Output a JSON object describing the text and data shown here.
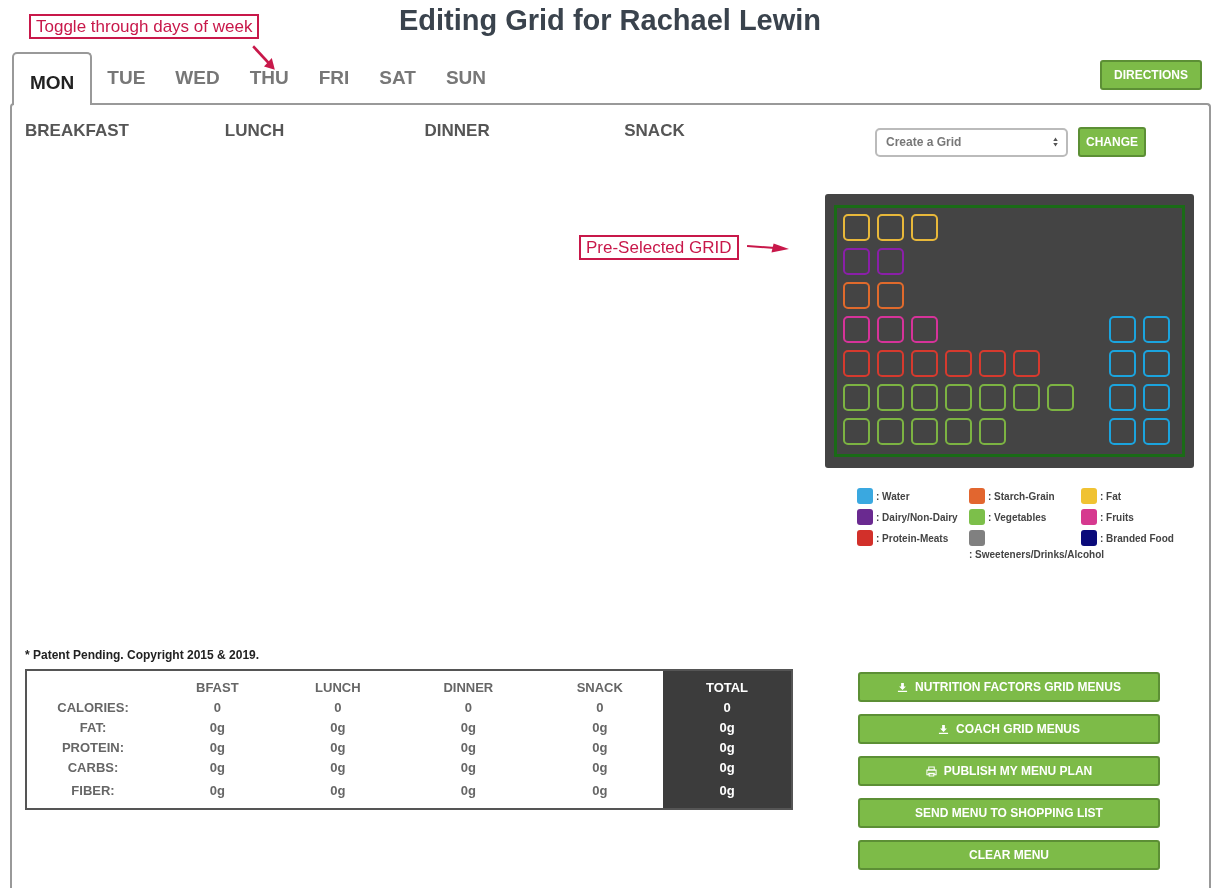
{
  "title": "Editing Grid for Rachael Lewin",
  "tabs": [
    {
      "label": "MON",
      "selected": true
    },
    {
      "label": "TUE",
      "selected": false
    },
    {
      "label": "WED",
      "selected": false
    },
    {
      "label": "THU",
      "selected": false
    },
    {
      "label": "FRI",
      "selected": false
    },
    {
      "label": "SAT",
      "selected": false
    },
    {
      "label": "SUN",
      "selected": false
    }
  ],
  "directions_button": "DIRECTIONS",
  "meals": [
    "BREAKFAST",
    "LUNCH",
    "DINNER",
    "SNACK"
  ],
  "grid_select": {
    "value": "Create a Grid"
  },
  "change_button": "CHANGE",
  "grid": {
    "rows": [
      {
        "cells": [
          {
            "color": "#e8b83a"
          },
          {
            "color": "#e8b83a"
          },
          {
            "color": "#e8b83a"
          }
        ],
        "side": []
      },
      {
        "cells": [
          {
            "color": "#8a1fa8"
          },
          {
            "color": "#8a1fa8"
          }
        ],
        "side": []
      },
      {
        "cells": [
          {
            "color": "#e06a2c"
          },
          {
            "color": "#e06a2c"
          }
        ],
        "side": []
      },
      {
        "cells": [
          {
            "color": "#d6339a"
          },
          {
            "color": "#d6339a"
          },
          {
            "color": "#d6339a"
          }
        ],
        "side": [
          {
            "color": "#1ba4de"
          },
          {
            "color": "#1ba4de"
          }
        ]
      },
      {
        "cells": [
          {
            "color": "#d63a2e"
          },
          {
            "color": "#d63a2e"
          },
          {
            "color": "#d63a2e"
          },
          {
            "color": "#d63a2e"
          },
          {
            "color": "#d63a2e"
          },
          {
            "color": "#d63a2e"
          }
        ],
        "side": [
          {
            "color": "#1ba4de"
          },
          {
            "color": "#1ba4de"
          }
        ]
      },
      {
        "cells": [
          {
            "color": "#7cb342"
          },
          {
            "color": "#7cb342"
          },
          {
            "color": "#7cb342"
          },
          {
            "color": "#7cb342"
          },
          {
            "color": "#7cb342"
          },
          {
            "color": "#7cb342"
          },
          {
            "color": "#7cb342"
          }
        ],
        "side": [
          {
            "color": "#1ba4de"
          },
          {
            "color": "#1ba4de"
          }
        ]
      },
      {
        "cells": [
          {
            "color": "#7cb342"
          },
          {
            "color": "#7cb342"
          },
          {
            "color": "#7cb342"
          },
          {
            "color": "#7cb342"
          },
          {
            "color": "#7cb342"
          }
        ],
        "side": [
          {
            "color": "#1ba4de"
          },
          {
            "color": "#1ba4de"
          }
        ]
      }
    ]
  },
  "legend": [
    {
      "label": ": Water",
      "color": "#3aa8e0"
    },
    {
      "label": ": Starch-Grain",
      "color": "#e2662f"
    },
    {
      "label": ": Fat",
      "color": "#f0c232"
    },
    {
      "label": ": Dairy/Non-Dairy",
      "color": "#6a2a90"
    },
    {
      "label": ": Vegetables",
      "color": "#7cbf4a"
    },
    {
      "label": ": Fruits",
      "color": "#d6398f"
    },
    {
      "label": ": Protein-Meats",
      "color": "#d2302a"
    },
    {
      "label": ": Sweeteners/Drinks/Alcohol",
      "color": "#808080"
    },
    {
      "label": ": Branded Food",
      "color": "#0a0a7a"
    }
  ],
  "copyright": "* Patent Pending. Copyright 2015 & 2019.",
  "nutrition_table": {
    "columns": [
      "BFAST",
      "LUNCH",
      "DINNER",
      "SNACK",
      "TOTAL"
    ],
    "rows": [
      {
        "label": "CALORIES:",
        "values": [
          "0",
          "0",
          "0",
          "0",
          "0"
        ]
      },
      {
        "label": "FAT:",
        "values": [
          "0g",
          "0g",
          "0g",
          "0g",
          "0g"
        ]
      },
      {
        "label": "PROTEIN:",
        "values": [
          "0g",
          "0g",
          "0g",
          "0g",
          "0g"
        ]
      },
      {
        "label": "CARBS:",
        "values": [
          "0g",
          "0g",
          "0g",
          "0g",
          "0g"
        ]
      },
      {
        "label": "FIBER:",
        "values": [
          "0g",
          "0g",
          "0g",
          "0g",
          "0g"
        ]
      }
    ]
  },
  "action_buttons": [
    {
      "label": "NUTRITION FACTORS GRID MENUS",
      "kind": "download"
    },
    {
      "label": "COACH GRID MENUS",
      "kind": "download"
    },
    {
      "label": "PUBLISH MY MENU PLAN",
      "kind": "print"
    },
    {
      "label": "SEND MENU TO SHOPPING LIST",
      "kind": "plain"
    },
    {
      "label": "CLEAR MENU",
      "kind": "plain"
    }
  ],
  "annotations": [
    {
      "text": "Toggle through days of week",
      "kind": "tabs"
    },
    {
      "text": "Pre-Selected GRID",
      "kind": "grid"
    }
  ]
}
